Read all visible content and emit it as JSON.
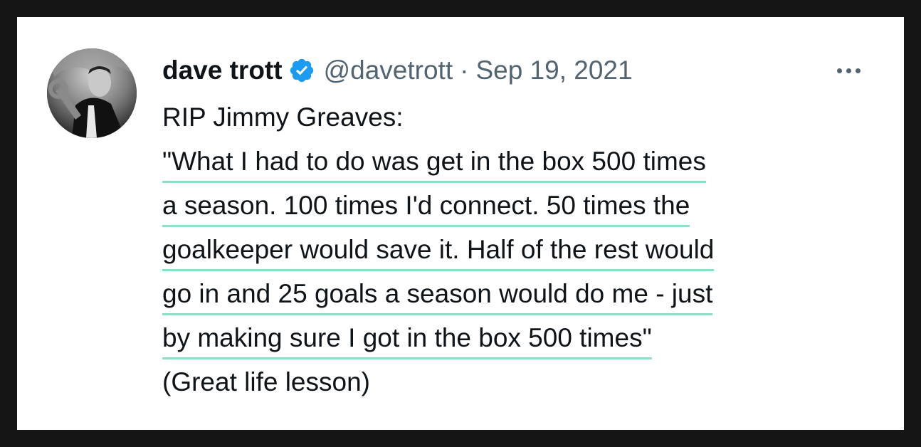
{
  "tweet": {
    "author_name": "dave trott",
    "handle": "@davetrott",
    "separator": "·",
    "date": "Sep 19, 2021",
    "lines": [
      "RIP Jimmy Greaves:",
      "\"What I had to do was get in the box 500 times",
      "a season. 100 times I'd connect. 50 times the",
      "goalkeeper would save it. Half of the rest would",
      "go in and 25 goals a season would do me - just",
      "by making sure I got in the box 500 times\"",
      "(Great life lesson)"
    ]
  },
  "icons": {
    "avatar": "avatar-photo",
    "verified": "verified-badge-icon",
    "more": "more-options-icon"
  },
  "colors": {
    "verified": "#1d9bf0",
    "highlight": "#8ddfc1",
    "secondary_text": "#536471",
    "primary_text": "#0f1419"
  }
}
